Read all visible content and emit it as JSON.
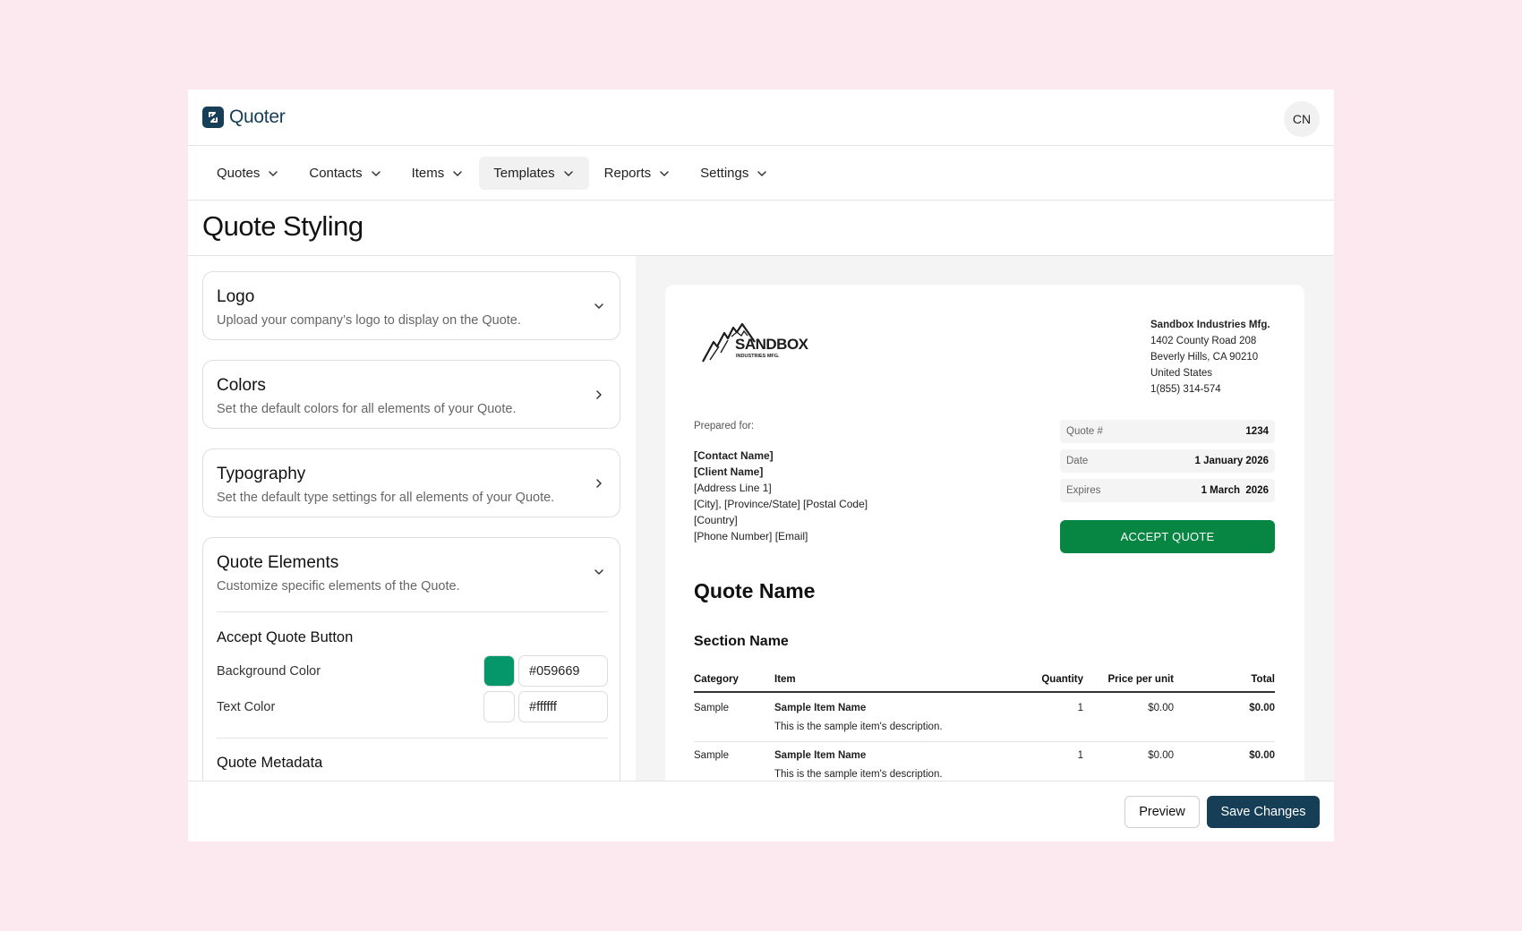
{
  "brand": {
    "name": "Quoter",
    "color": "#163f57"
  },
  "user": {
    "initials": "CN"
  },
  "nav": [
    {
      "label": "Quotes",
      "icon": "chevron-down-icon"
    },
    {
      "label": "Contacts",
      "icon": "chevron-down-icon"
    },
    {
      "label": "Items",
      "icon": "chevron-down-icon"
    },
    {
      "label": "Templates",
      "icon": "chevron-down-icon",
      "active": true
    },
    {
      "label": "Reports",
      "icon": "chevron-down-icon"
    },
    {
      "label": "Settings",
      "icon": "chevron-down-icon"
    }
  ],
  "page": {
    "title": "Quote Styling"
  },
  "panels": {
    "logo": {
      "title": "Logo",
      "desc": "Upload your company’s logo to display on the Quote.",
      "icon": "chevron-down-icon"
    },
    "colors": {
      "title": "Colors",
      "desc": "Set the default colors for all elements of your Quote.",
      "icon": "chevron-right-icon"
    },
    "typography": {
      "title": "Typography",
      "desc": "Set the default type settings for all elements of your Quote.",
      "icon": "chevron-right-icon"
    },
    "elements": {
      "title": "Quote Elements",
      "desc": "Customize specific elements of the Quote.",
      "icon": "chevron-down-icon",
      "accept_section": "Accept Quote Button",
      "bg_label": "Background Color",
      "bg_value": "#059669",
      "text_label": "Text Color",
      "text_value": "#ffffff",
      "metadata_section": "Quote Metadata"
    }
  },
  "preview": {
    "logo_text": "SANDBOX",
    "logo_sub": "INDUSTRIES MFG.",
    "company": {
      "name": "Sandbox Industries Mfg.",
      "address1": "1402 County Road 208",
      "address2": "Beverly Hills, CA 90210",
      "country": "United States",
      "phone": "1(855) 314-574"
    },
    "prepared_for": "Prepared for:",
    "client": {
      "contact": "[Contact Name]",
      "client": "[Client Name]",
      "address": "[Address Line 1]",
      "city": "[City], [Province/State] [Postal Code]",
      "country": "[Country]",
      "phone": "[Phone Number] [Email]"
    },
    "meta": [
      {
        "label": "Quote #",
        "value": "1234"
      },
      {
        "label": "Date",
        "value": "1 January 2026"
      },
      {
        "label": "Expires",
        "value": "1 March  2026"
      }
    ],
    "accept_label": "ACCEPT QUOTE",
    "accept_color": "#078542",
    "quote_name": "Quote Name",
    "section_name": "Section Name",
    "columns": [
      "Category",
      "Item",
      "Quantity",
      "Price per unit",
      "Total"
    ],
    "rows": [
      {
        "category": "Sample",
        "item": "Sample Item Name",
        "desc": "This is the sample item's description.",
        "qty": "1",
        "price": "$0.00",
        "total": "$0.00"
      },
      {
        "category": "Sample",
        "item": "Sample Item Name",
        "desc": "This is the sample item's description.",
        "qty": "1",
        "price": "$0.00",
        "total": "$0.00"
      }
    ]
  },
  "footer": {
    "preview": "Preview",
    "save": "Save Changes"
  }
}
